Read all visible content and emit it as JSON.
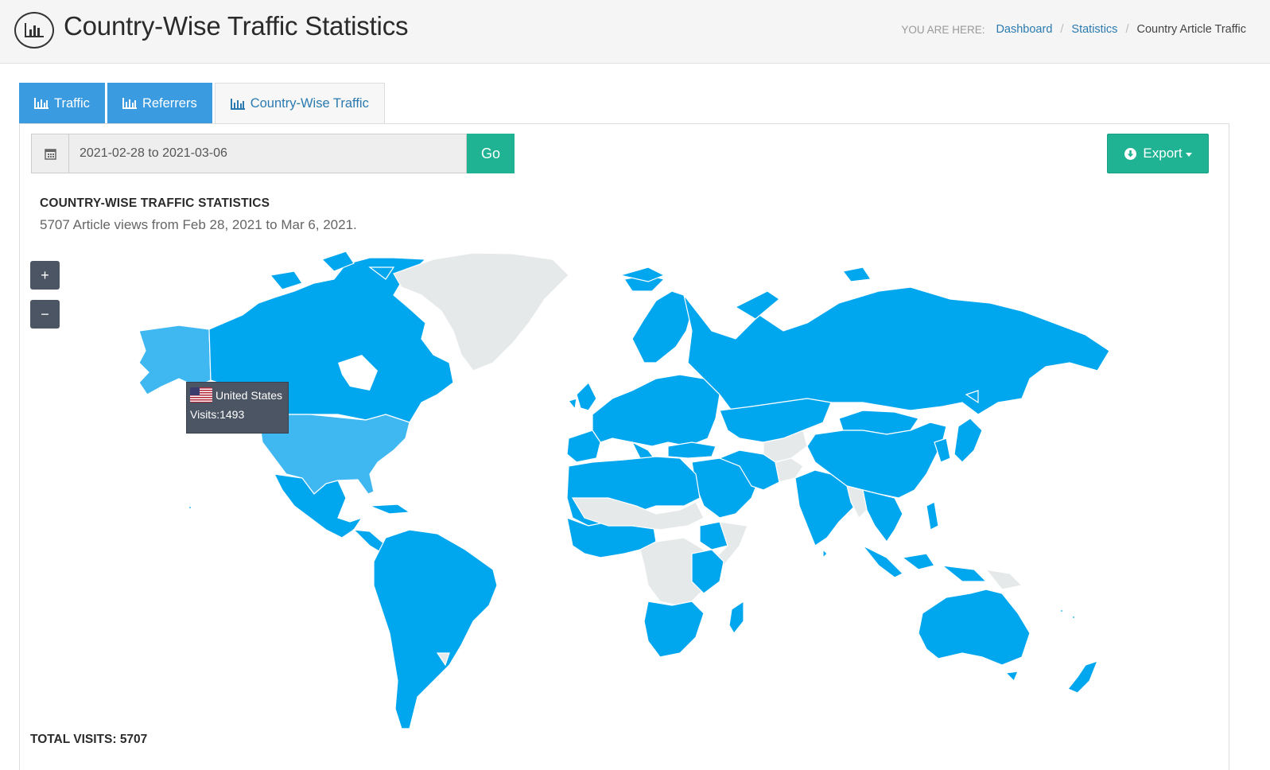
{
  "header": {
    "title": "Country-Wise Traffic Statistics",
    "icon": "bar-chart-icon",
    "breadcrumb": {
      "label": "YOU ARE HERE:",
      "items": [
        "Dashboard",
        "Statistics"
      ],
      "current": "Country Article Traffic"
    }
  },
  "tabs": [
    {
      "label": "Traffic",
      "icon": "bar-chart-icon",
      "state": "filled"
    },
    {
      "label": "Referrers",
      "icon": "bar-chart-icon",
      "state": "filled"
    },
    {
      "label": "Country-Wise Traffic",
      "icon": "bar-chart-icon",
      "state": "active"
    }
  ],
  "filter": {
    "date_range": "2021-02-28 to 2021-03-06",
    "calendar_icon": "calendar-icon",
    "go_label": "Go"
  },
  "export": {
    "label": "Export",
    "icon": "download-icon"
  },
  "stats": {
    "title": "COUNTRY-WISE TRAFFIC STATISTICS",
    "subtitle": "5707 Article views from Feb 28, 2021 to Mar 6, 2021."
  },
  "map": {
    "zoom_in": "+",
    "zoom_out": "−",
    "colors": {
      "visited": "#00a6ee",
      "highlight": "#3fb8f2",
      "no_data": "#e6e9ea"
    },
    "tooltip": {
      "country": "United States",
      "visits": "Visits:1493"
    }
  },
  "footer": {
    "total_visits": "TOTAL VISITS: 5707"
  }
}
